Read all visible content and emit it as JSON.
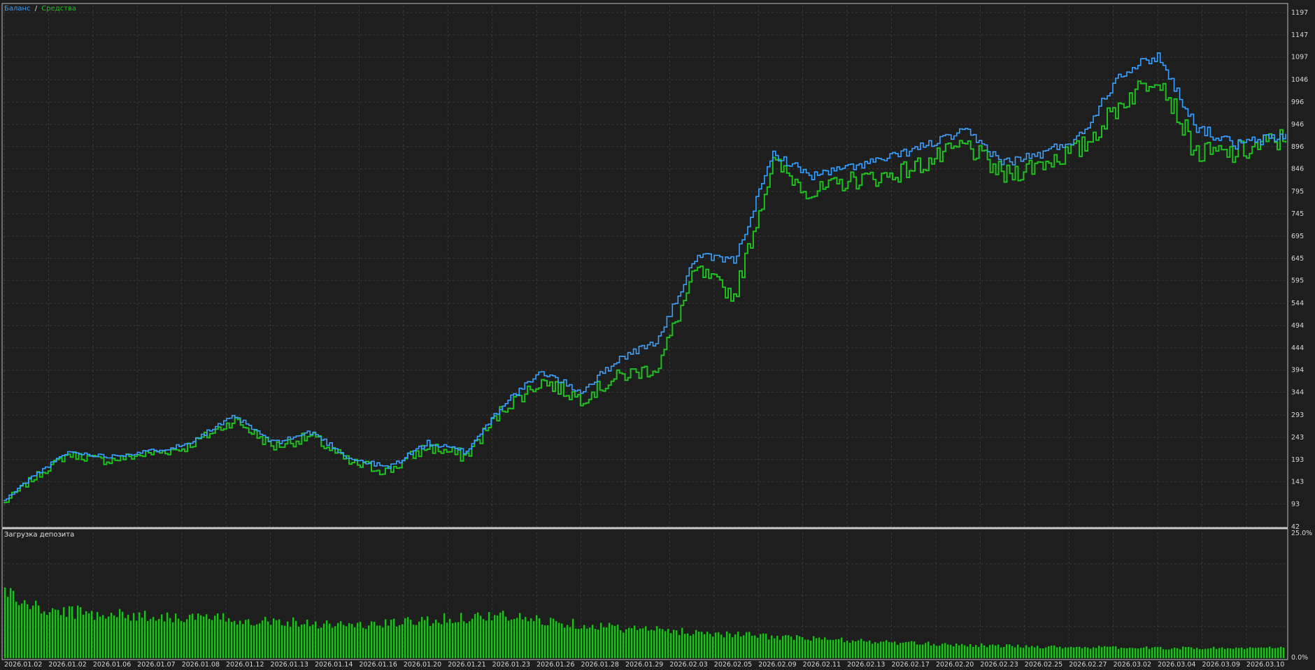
{
  "legend": {
    "balance_label": "Баланс",
    "separator": "/",
    "equity_label": "Средства"
  },
  "lower_panel": {
    "title": "Загрузка депозита"
  },
  "colors": {
    "background": "#1e1e1e",
    "plot_background": "#202020",
    "grid": "#3c3c3c",
    "frame": "#bdbdbd",
    "balance_line": "#3aa0ff",
    "equity_line": "#1fbf1f",
    "load_bars": "#1fbf1f",
    "text": "#e0e0e0"
  },
  "chart_data": [
    {
      "type": "line",
      "ylim": [
        42,
        1197
      ],
      "y_ticks": [
        1197,
        1147,
        1097,
        1046,
        996,
        946,
        896,
        846,
        795,
        745,
        695,
        645,
        595,
        544,
        494,
        444,
        394,
        344,
        293,
        243,
        193,
        143,
        93,
        42
      ],
      "x_tick_labels": [
        "2026.01.02",
        "2026.01.02",
        "2026.01.06",
        "2026.01.07",
        "2026.01.08",
        "2026.01.12",
        "2026.01.13",
        "2026.01.14",
        "2026.01.16",
        "2026.01.20",
        "2026.01.21",
        "2026.01.23",
        "2026.01.26",
        "2026.01.28",
        "2026.01.29",
        "2026.02.03",
        "2026.02.05",
        "2026.02.09",
        "2026.02.11",
        "2026.02.13",
        "2026.02.17",
        "2026.02.20",
        "2026.02.23",
        "2026.02.25",
        "2026.02.27",
        "2026.03.02",
        "2026.03.04",
        "2026.03.09",
        "2026.03.10"
      ],
      "grid": true,
      "series": [
        {
          "name": "Баланс",
          "x": [
            0,
            0.02,
            0.05,
            0.08,
            0.11,
            0.14,
            0.18,
            0.21,
            0.24,
            0.27,
            0.3,
            0.33,
            0.36,
            0.39,
            0.42,
            0.45,
            0.48,
            0.51,
            0.54,
            0.57,
            0.6,
            0.63,
            0.66,
            0.69,
            0.72,
            0.75,
            0.78,
            0.81,
            0.84,
            0.87,
            0.9,
            0.93,
            0.96,
            1.0
          ],
          "values": [
            100,
            150,
            210,
            200,
            210,
            225,
            290,
            230,
            255,
            195,
            175,
            230,
            210,
            320,
            390,
            345,
            420,
            460,
            650,
            640,
            880,
            830,
            850,
            870,
            900,
            930,
            860,
            880,
            920,
            1060,
            1100,
            940,
            900,
            920
          ]
        },
        {
          "name": "Средства",
          "x": [
            0,
            0.02,
            0.05,
            0.08,
            0.11,
            0.14,
            0.18,
            0.21,
            0.24,
            0.27,
            0.3,
            0.33,
            0.36,
            0.39,
            0.42,
            0.45,
            0.48,
            0.51,
            0.54,
            0.57,
            0.6,
            0.63,
            0.66,
            0.69,
            0.72,
            0.75,
            0.78,
            0.81,
            0.84,
            0.87,
            0.9,
            0.93,
            0.96,
            1.0
          ],
          "values": [
            95,
            145,
            205,
            190,
            205,
            218,
            282,
            222,
            245,
            185,
            168,
            222,
            200,
            310,
            370,
            330,
            380,
            400,
            620,
            560,
            860,
            790,
            820,
            830,
            860,
            900,
            830,
            860,
            890,
            990,
            1060,
            880,
            880,
            915
          ]
        }
      ]
    },
    {
      "type": "bar",
      "title": "Загрузка депозита",
      "ylim": [
        0,
        25
      ],
      "y_tick_labels": [
        "25.0%",
        "0.0%"
      ],
      "series": [
        {
          "name": "Загрузка депозита",
          "keyframes_x": [
            0,
            0.01,
            0.03,
            0.1,
            0.2,
            0.28,
            0.38,
            0.48,
            0.55,
            0.62,
            0.7,
            0.8,
            0.9,
            1.0
          ],
          "keyframes_values": [
            14,
            11.5,
            9.5,
            8.5,
            7.5,
            6.5,
            8.5,
            6.0,
            5.0,
            4.0,
            3.0,
            2.3,
            2.0,
            2.0
          ]
        }
      ]
    }
  ]
}
